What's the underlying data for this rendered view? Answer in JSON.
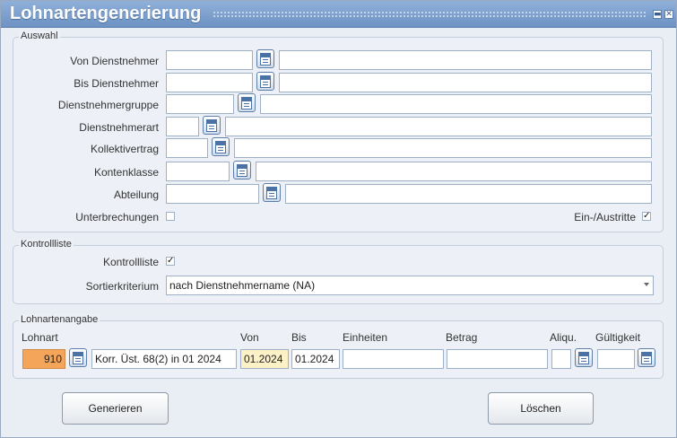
{
  "window": {
    "title": "Lohnartengenerierung",
    "minimize_glyph": "▬",
    "close_glyph": "✕"
  },
  "auswahl": {
    "legend": "Auswahl",
    "von_dienstnehmer": {
      "label": "Von Dienstnehmer",
      "code": "",
      "name": ""
    },
    "bis_dienstnehmer": {
      "label": "Bis Dienstnehmer",
      "code": "",
      "name": ""
    },
    "dienstnehmergruppe": {
      "label": "Dienstnehmergruppe",
      "code": "",
      "name": ""
    },
    "dienstnehmerart": {
      "label": "Dienstnehmerart",
      "code": "",
      "name": ""
    },
    "kollektivertrag": {
      "label": "Kollektivertrag",
      "code": "",
      "name": ""
    },
    "kontenklasse": {
      "label": "Kontenklasse",
      "code": "",
      "name": ""
    },
    "abteilung": {
      "label": "Abteilung",
      "code": "",
      "name": ""
    },
    "unterbrechungen": {
      "label": "Unterbrechungen",
      "checked": false,
      "mark": ""
    },
    "ein_austritte": {
      "label": "Ein-/Austritte",
      "checked": true,
      "mark": "✓"
    }
  },
  "kontrollliste": {
    "legend": "Kontrollliste",
    "kontrollliste_check": {
      "label": "Kontrollliste",
      "checked": true,
      "mark": "✓"
    },
    "sortierkriterium": {
      "label": "Sortierkriterium",
      "value": "nach Dienstnehmername (NA)"
    }
  },
  "lohnartenangabe": {
    "legend": "Lohnartenangabe",
    "headers": {
      "lohnart": "Lohnart",
      "von": "Von",
      "bis": "Bis",
      "einheiten": "Einheiten",
      "betrag": "Betrag",
      "aliqu": "Aliqu.",
      "gueltigkeit": "Gültigkeit"
    },
    "row": {
      "lohnart_code": "910",
      "lohnart_name": "Korr. Üst. 68(2) in 01 2024",
      "von": "01.2024",
      "bis": "01.2024",
      "einheiten": "",
      "betrag": "",
      "aliqu": "",
      "gueltigkeit": ""
    }
  },
  "buttons": {
    "generieren": "Generieren",
    "loeschen": "Löschen"
  },
  "colors": {
    "lohnart_code_bg": "#f5a55a",
    "von_bg": "#fdf1c8"
  }
}
